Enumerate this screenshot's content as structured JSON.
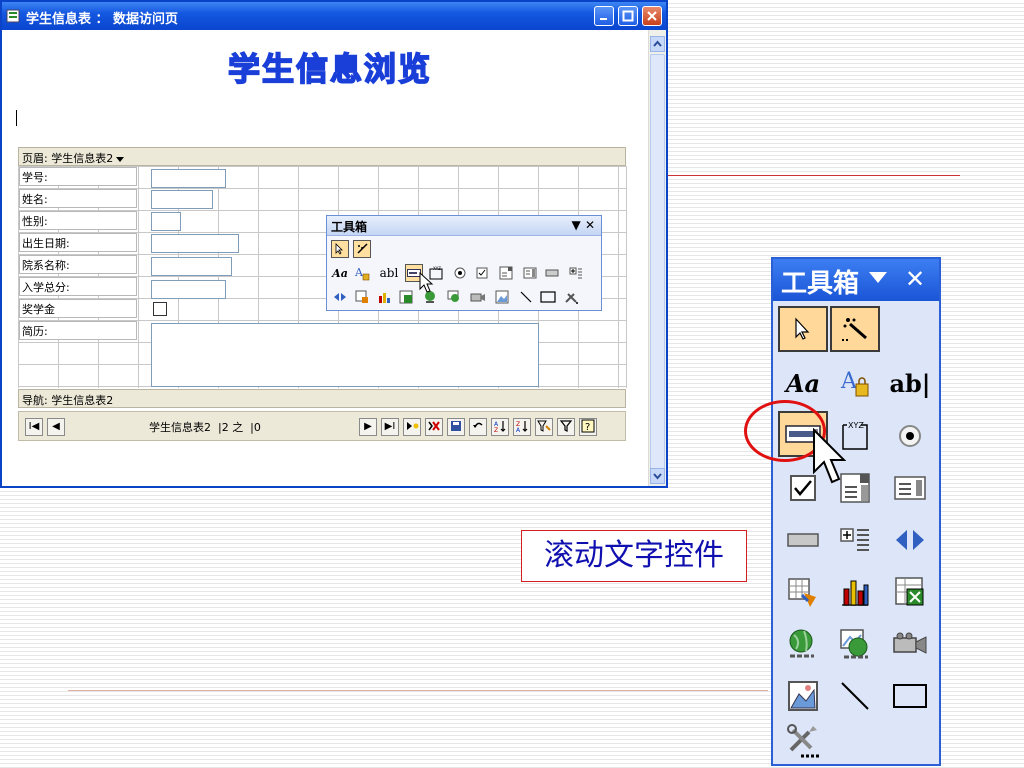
{
  "window": {
    "title": "学生信息表 ： 数据访问页"
  },
  "page": {
    "heading": "学生信息浏览",
    "header_section": "页眉: 学生信息表2",
    "nav_section": "导航: 学生信息表2"
  },
  "fields": [
    {
      "label": "学号:"
    },
    {
      "label": "姓名:"
    },
    {
      "label": "性别:"
    },
    {
      "label": "出生日期:"
    },
    {
      "label": "院系名称:"
    },
    {
      "label": "入学总分:"
    },
    {
      "label": "奖学金"
    },
    {
      "label": "简历:"
    }
  ],
  "nav": {
    "record_text": "学生信息表2  |2 之  |0",
    "first": "I◀",
    "prev": "◀",
    "next": "▶",
    "last": "▶I"
  },
  "toolbox_small": {
    "title": "工具箱",
    "label_text": "abl"
  },
  "toolbox_large": {
    "title": "工具箱",
    "aa_text": "Aa",
    "ab_text": "ab|"
  },
  "callout": {
    "text": "滚动文字控件"
  },
  "colors": {
    "title_blue": "#0a46cf",
    "accent_red": "#e01010",
    "callout_text": "#1010b0"
  }
}
